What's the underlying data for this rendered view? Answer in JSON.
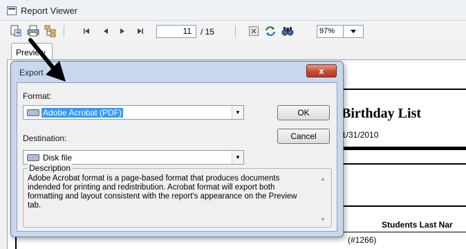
{
  "window": {
    "title": "Report Viewer"
  },
  "toolbar": {
    "current_page": "11",
    "total_pages": "/ 15",
    "zoom": "97%",
    "icons": [
      "export-icon",
      "print-icon",
      "tree-icon",
      "first-page-icon",
      "prev-page-icon",
      "next-page-icon",
      "last-page-icon",
      "close-group-icon",
      "refresh-icon",
      "search-icon",
      "zoom-dropdown-icon"
    ]
  },
  "tabs": {
    "preview": "Preview"
  },
  "report": {
    "title": "Birthday List",
    "date": "1/31/2010",
    "column_header": "Students Last Nar",
    "row_text": "(#1266)"
  },
  "dialog": {
    "title": "Export",
    "close_label": "x",
    "format_label": "Format:",
    "format_value": "Adobe Acrobat (PDF)",
    "destination_label": "Destination:",
    "destination_value": "Disk file",
    "ok_label": "OK",
    "cancel_label": "Cancel",
    "description_legend": "Description",
    "description_text": "Adobe Acrobat format is a page-based format that produces documents indended for printing and redistribution.  Acrobat format will export both formatting and layout consistent with the report's appearance on the Preview tab."
  },
  "colors": {
    "selection": "#3399ff",
    "dialog_frame": "#c7d8ee",
    "close_button": "#c84a32"
  }
}
